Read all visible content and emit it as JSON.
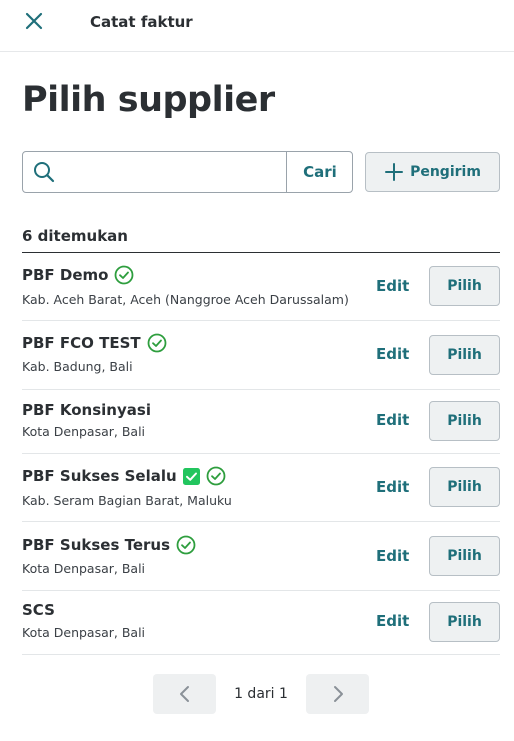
{
  "header": {
    "title": "Catat faktur"
  },
  "page": {
    "title": "Pilih supplier"
  },
  "search": {
    "value": "",
    "placeholder": "",
    "button_label": "Cari"
  },
  "actions": {
    "sender_label": "Pengirim"
  },
  "results": {
    "count_label": "6 ditemukan"
  },
  "suppliers": [
    {
      "name": "PBF Demo",
      "location": "Kab. Aceh Barat, Aceh (Nanggroe Aceh Darussalam)",
      "verified": true,
      "checked": false,
      "edit_label": "Edit",
      "pick_label": "Pilih"
    },
    {
      "name": "PBF FCO TEST",
      "location": "Kab. Badung, Bali",
      "verified": true,
      "checked": false,
      "edit_label": "Edit",
      "pick_label": "Pilih"
    },
    {
      "name": "PBF Konsinyasi",
      "location": "Kota Denpasar, Bali",
      "verified": false,
      "checked": false,
      "edit_label": "Edit",
      "pick_label": "Pilih"
    },
    {
      "name": "PBF Sukses Selalu",
      "location": "Kab. Seram Bagian Barat, Maluku",
      "verified": true,
      "checked": true,
      "edit_label": "Edit",
      "pick_label": "Pilih"
    },
    {
      "name": "PBF Sukses Terus",
      "location": "Kota Denpasar, Bali",
      "verified": true,
      "checked": false,
      "edit_label": "Edit",
      "pick_label": "Pilih"
    },
    {
      "name": "SCS",
      "location": "Kota Denpasar, Bali",
      "verified": false,
      "checked": false,
      "edit_label": "Edit",
      "pick_label": "Pilih"
    }
  ],
  "pagination": {
    "info": "1 dari 1"
  },
  "colors": {
    "accent": "#1f6f7a",
    "verified": "#2e9e3e",
    "checkbox": "#22c55e"
  },
  "icons": {
    "close": "close-icon",
    "search": "search-icon",
    "add": "plus-icon",
    "verified": "verified-check-icon",
    "checkbox": "checkbox-checked-icon",
    "prev": "chevron-left-icon",
    "next": "chevron-right-icon"
  }
}
